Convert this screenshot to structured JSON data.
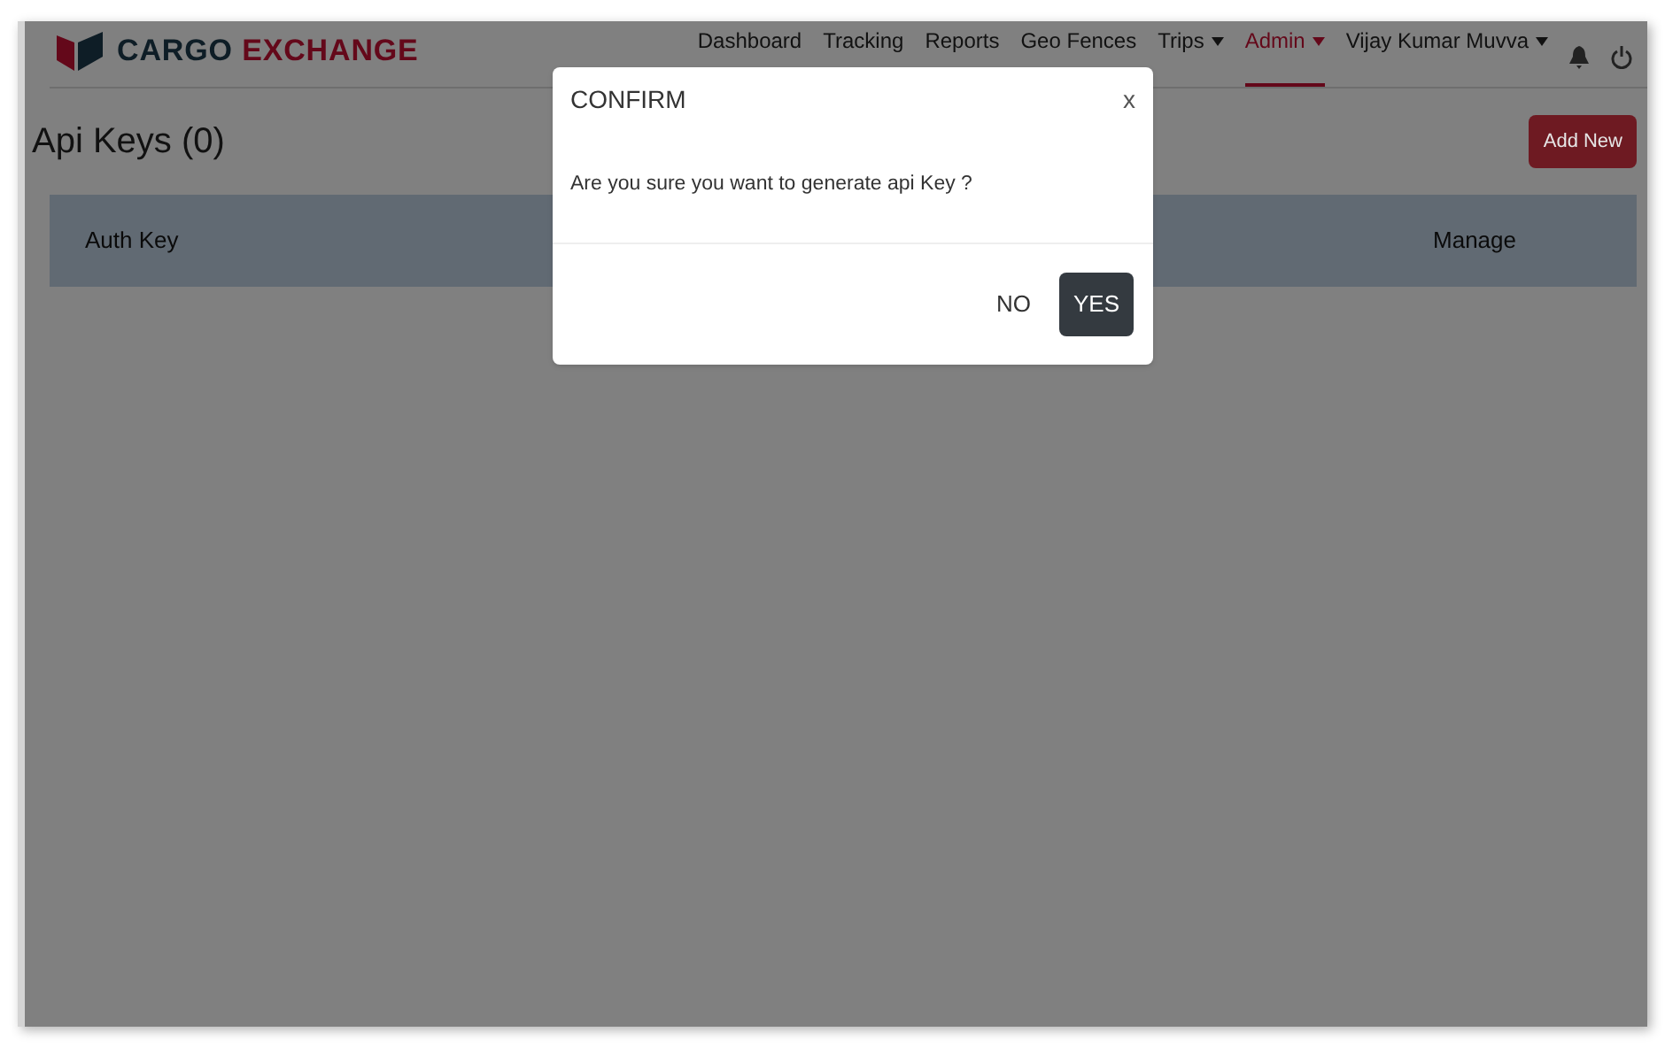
{
  "brand": {
    "word_1": "CARGO",
    "word_2": "EXCHANGE"
  },
  "nav": [
    {
      "label": "Dashboard",
      "selected": false,
      "dropdown": false
    },
    {
      "label": "Tracking",
      "selected": false,
      "dropdown": false
    },
    {
      "label": "Reports",
      "selected": false,
      "dropdown": false
    },
    {
      "label": "Geo Fences",
      "selected": false,
      "dropdown": false
    },
    {
      "label": "Trips",
      "selected": false,
      "dropdown": true
    },
    {
      "label": "Admin",
      "selected": true,
      "dropdown": true
    },
    {
      "label": "Vijay Kumar Muvva",
      "selected": false,
      "dropdown": true
    }
  ],
  "page": {
    "title": "Api Keys (0)",
    "add_button": "Add New"
  },
  "table": {
    "columns": [
      "Auth Key",
      "Manage"
    ]
  },
  "dialog": {
    "title": "CONFIRM",
    "close": "x",
    "message": "Are you sure you want to generate api Key ?",
    "buttons": [
      {
        "label": "NO",
        "kind": "plain"
      },
      {
        "label": "YES",
        "kind": "primary"
      }
    ]
  }
}
